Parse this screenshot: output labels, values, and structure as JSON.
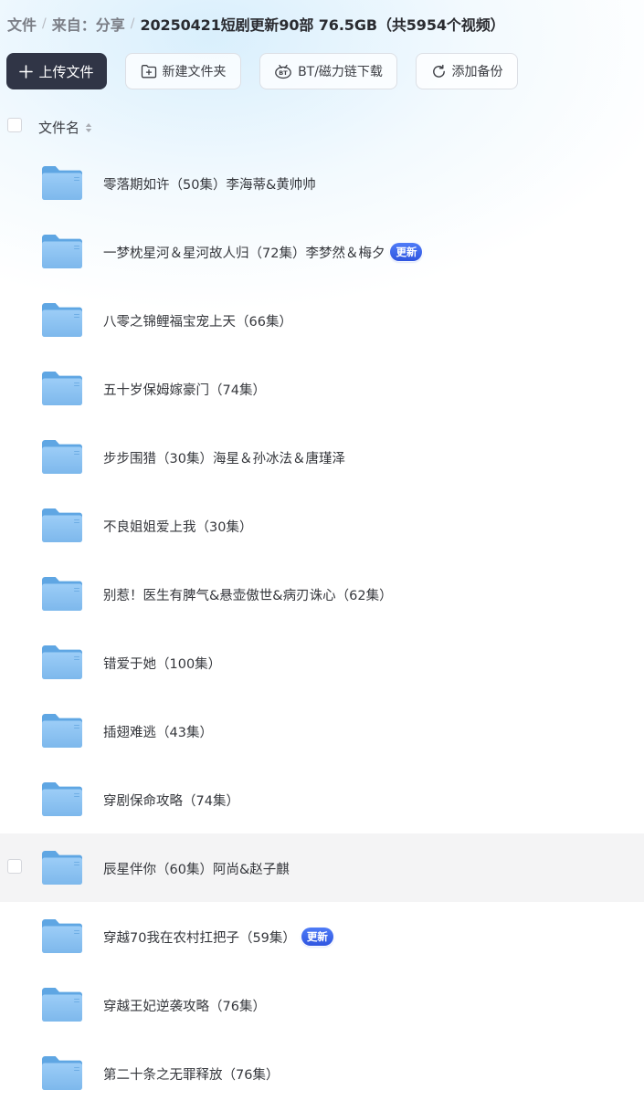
{
  "breadcrumb": {
    "items": [
      "文件",
      "来自：分享"
    ],
    "separator": "/",
    "current": "20250421短剧更新90部 76.5GB（共5954个视频）"
  },
  "toolbar": {
    "upload_label": "上传文件",
    "new_folder_label": "新建文件夹",
    "bt_label": "BT/磁力链下载",
    "backup_label": "添加备份"
  },
  "list_header": {
    "name_label": "文件名"
  },
  "files": [
    {
      "name": "零落期如许（50集）李海蒂&黄帅帅",
      "badge": ""
    },
    {
      "name": "一梦枕星河＆星河故人归（72集）李梦然＆梅夕",
      "badge": "更新"
    },
    {
      "name": "八零之锦鲤福宝宠上天（66集）",
      "badge": ""
    },
    {
      "name": "五十岁保姆嫁豪门（74集）",
      "badge": ""
    },
    {
      "name": "步步围猎（30集）海星＆孙冰法＆唐瑾泽",
      "badge": ""
    },
    {
      "name": "不良姐姐爱上我（30集）",
      "badge": ""
    },
    {
      "name": "别惹！医生有脾气&悬壶傲世&病刃诛心（62集）",
      "badge": ""
    },
    {
      "name": "错爱于她（100集）",
      "badge": ""
    },
    {
      "name": "插翅难逃（43集）",
      "badge": ""
    },
    {
      "name": "穿剧保命攻略（74集）",
      "badge": ""
    },
    {
      "name": "辰星伴你（60集）阿尚&赵子麒",
      "badge": ""
    },
    {
      "name": "穿越70我在农村扛把子（59集）",
      "badge": "更新"
    },
    {
      "name": "穿越王妃逆袭攻略（76集）",
      "badge": ""
    },
    {
      "name": "第二十条之无罪释放（76集）",
      "badge": ""
    }
  ],
  "hovered_row": 10,
  "colors": {
    "primary_button": "#303546",
    "badge": "#3b63ea",
    "folder": "#7db8ec",
    "row_hover": "#f4f4f5"
  }
}
